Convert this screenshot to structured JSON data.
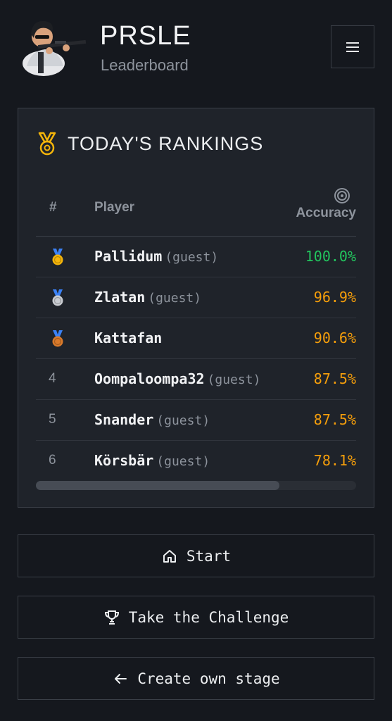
{
  "app": {
    "title": "PRSLE",
    "subtitle": "Leaderboard"
  },
  "card": {
    "title": "TODAY'S RANKINGS"
  },
  "table": {
    "headers": {
      "rank": "#",
      "player": "Player",
      "accuracy": "Accuracy"
    },
    "rows": [
      {
        "rank": "1",
        "medal": "gold",
        "name": "Pallidum",
        "guest": "(guest)",
        "accuracy": "100.0%",
        "color": "#22c55e"
      },
      {
        "rank": "2",
        "medal": "silver",
        "name": "Zlatan",
        "guest": "(guest)",
        "accuracy": "96.9%",
        "color": "#f59e0b"
      },
      {
        "rank": "3",
        "medal": "bronze",
        "name": "Kattafan",
        "guest": "",
        "accuracy": "90.6%",
        "color": "#f59e0b"
      },
      {
        "rank": "4",
        "medal": "",
        "name": "Oompaloompa32",
        "guest": "(guest)",
        "accuracy": "87.5%",
        "color": "#f59e0b"
      },
      {
        "rank": "5",
        "medal": "",
        "name": "Snander",
        "guest": "(guest)",
        "accuracy": "87.5%",
        "color": "#f59e0b"
      },
      {
        "rank": "6",
        "medal": "",
        "name": "Körsbär",
        "guest": "(guest)",
        "accuracy": "78.1%",
        "color": "#f59e0b"
      }
    ],
    "scroll_position": 0.76
  },
  "buttons": {
    "start": "Start",
    "challenge": "Take the Challenge",
    "create": "Create own stage"
  },
  "icons": {
    "menu": "hamburger-menu-icon",
    "title": "medal-icon",
    "accuracy": "target-icon",
    "start": "home-icon",
    "challenge": "trophy-icon",
    "create": "arrow-left-icon"
  },
  "colors": {
    "background": "#15181e",
    "card": "#1f232a",
    "accent_gold": "#f5b50a",
    "green": "#22c55e",
    "orange": "#f59e0b"
  }
}
